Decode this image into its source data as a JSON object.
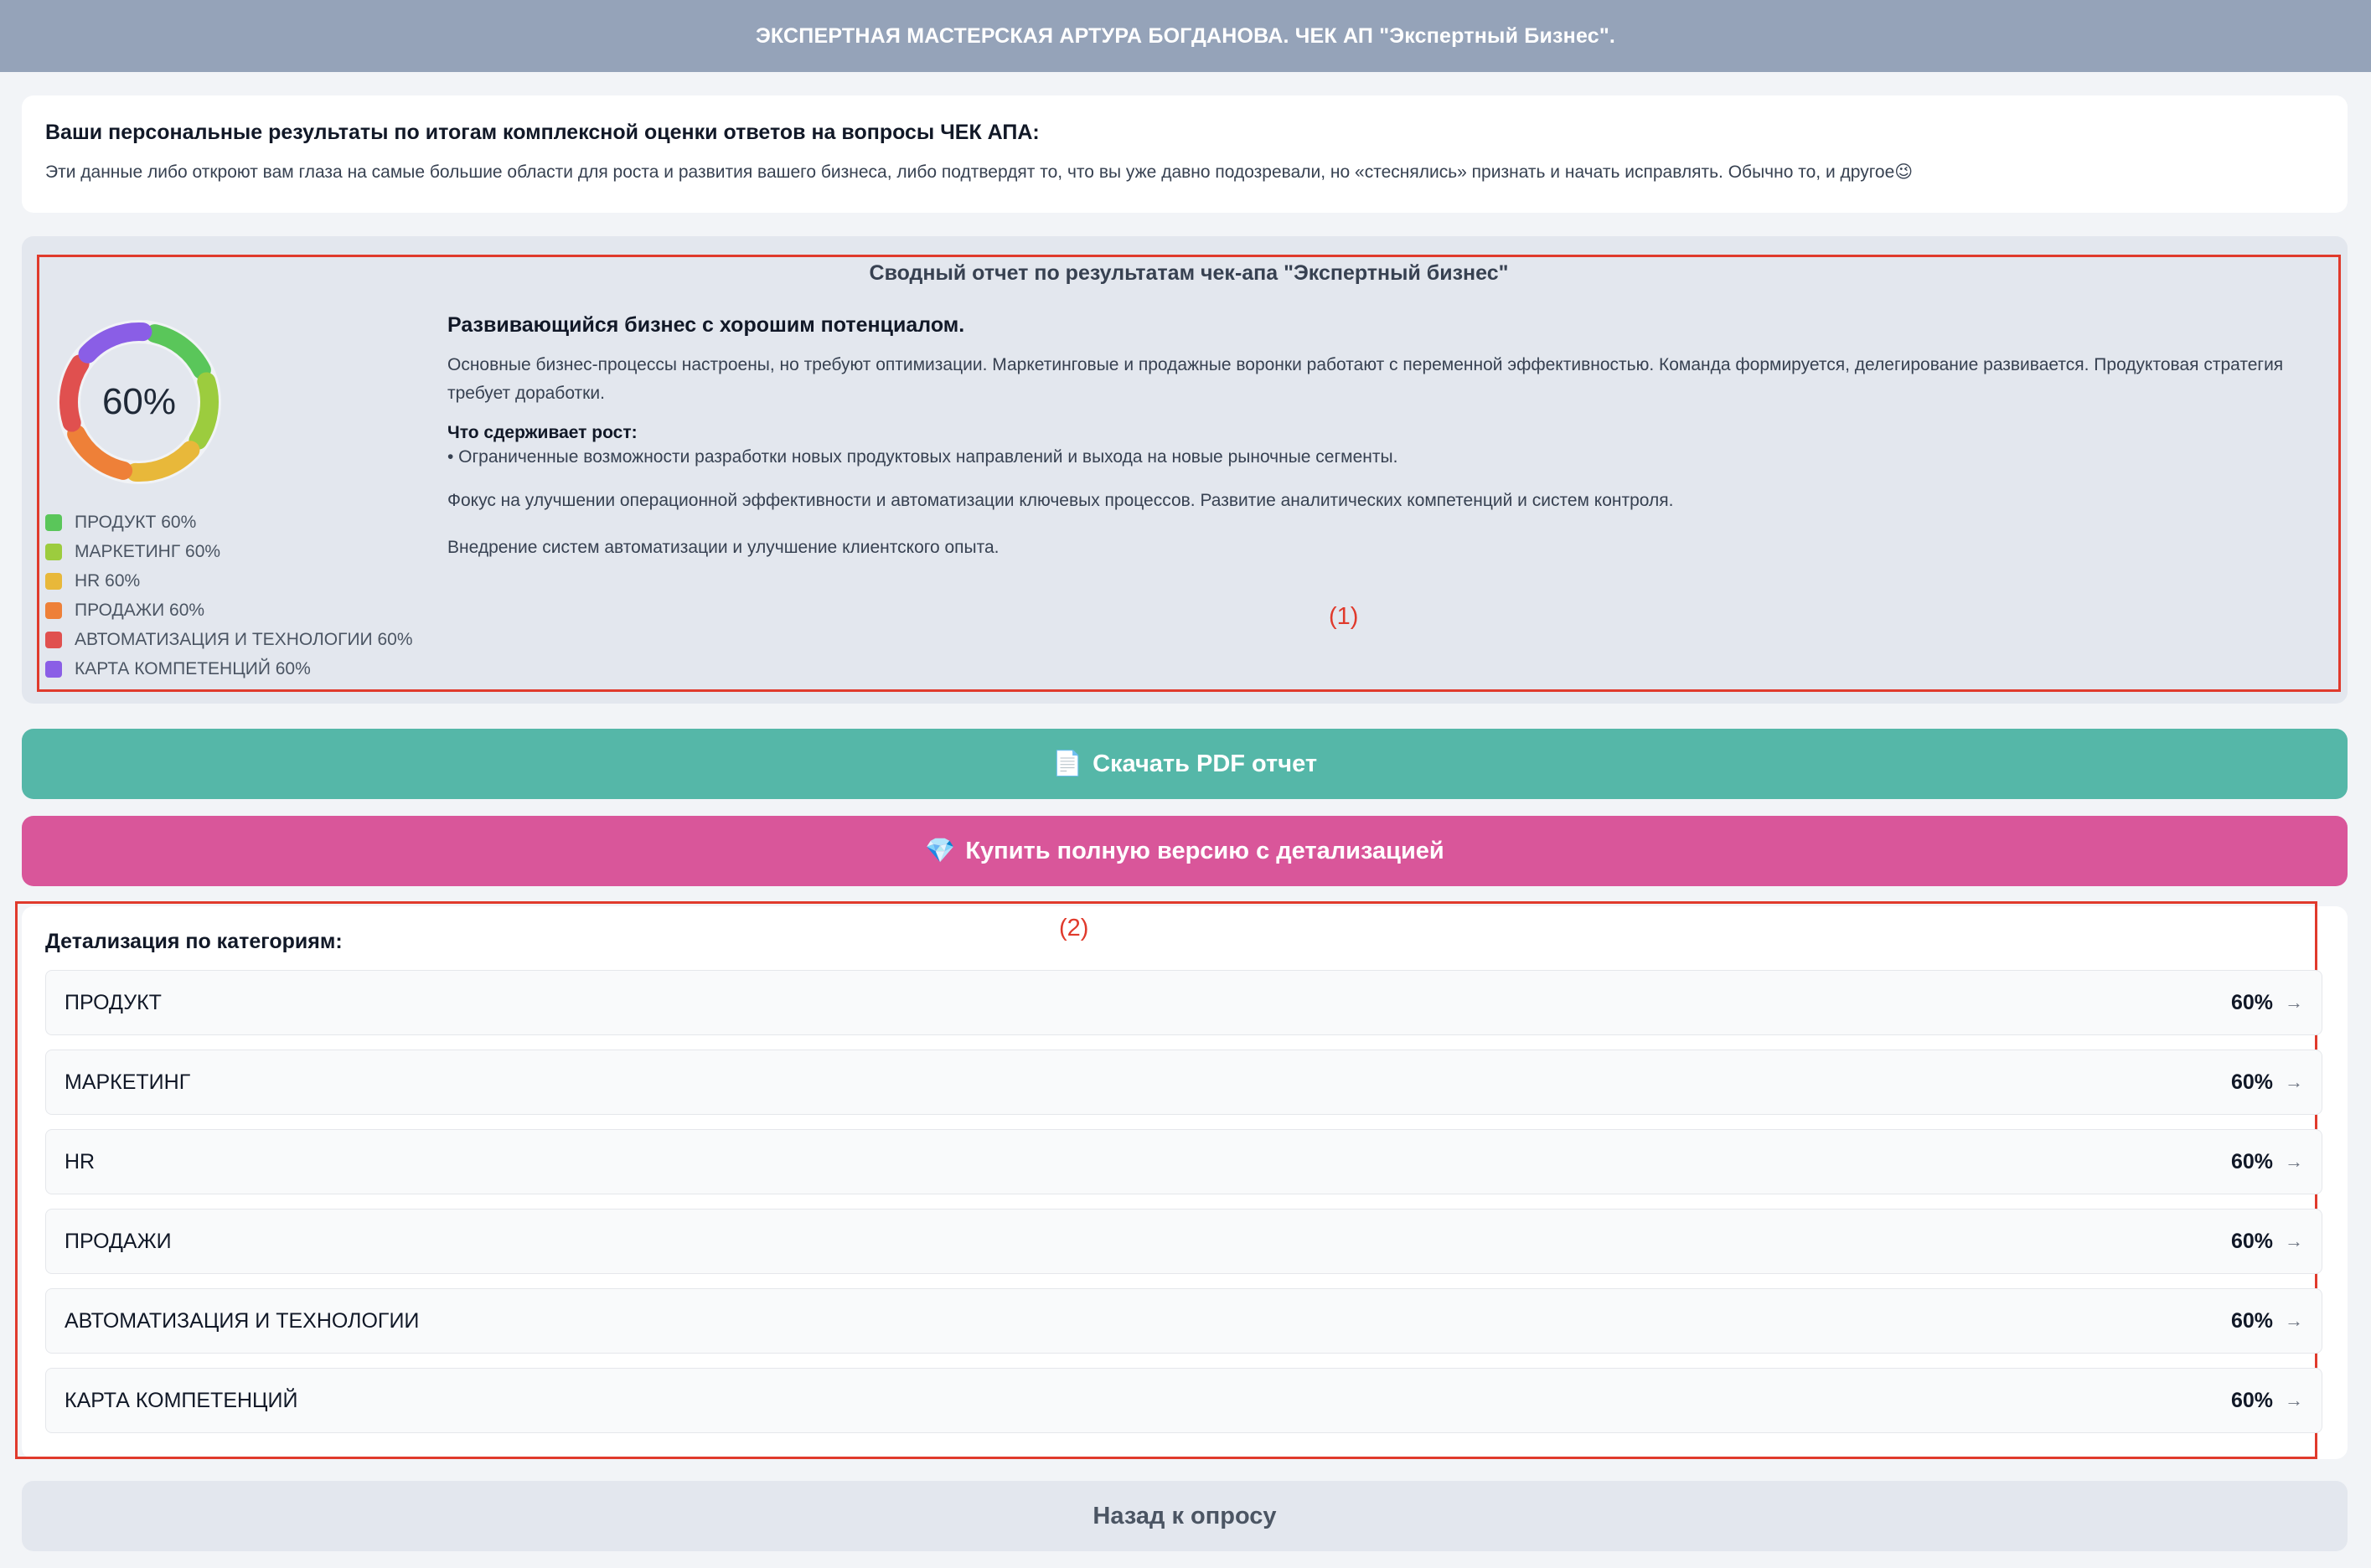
{
  "header": {
    "title": "ЭКСПЕРТНАЯ МАСТЕРСКАЯ АРТУРА БОГДАНОВА. ЧЕК АП \"Экспертный Бизнес\"."
  },
  "intro": {
    "title": "Ваши персональные результаты по итогам комплексной оценки ответов на вопросы ЧЕК АПА:",
    "text": "Эти данные либо откроют вам глаза на самые большие области для роста и развития вашего бизнеса, либо подтвердят то, что вы уже давно подозревали, но «стеснялись» признать и начать исправлять. Обычно то, и другое😉"
  },
  "summary": {
    "title": "Сводный отчет по результатам чек-апа \"Экспертный бизнес\"",
    "score_label": "60%",
    "score_value": 60,
    "legend": [
      {
        "label": "ПРОДУКТ 60%",
        "color": "#5ac65a",
        "value": 60
      },
      {
        "label": "МАРКЕТИНГ 60%",
        "color": "#9ccc3e",
        "value": 60
      },
      {
        "label": "HR 60%",
        "color": "#e8b83a",
        "value": 60
      },
      {
        "label": "ПРОДАЖИ 60%",
        "color": "#ee8038",
        "value": 60
      },
      {
        "label": "АВТОМАТИЗАЦИЯ И ТЕХНОЛОГИИ 60%",
        "color": "#e0504f",
        "value": 60
      },
      {
        "label": "КАРТА КОМПЕТЕНЦИЙ 60%",
        "color": "#8a5ee6",
        "value": 60
      }
    ],
    "heading": "Развивающийся бизнес с хорошим потенциалом.",
    "description": "Основные бизнес-процессы настроены, но требуют оптимизации. Маркетинговые и продажные воронки работают с переменной эффективностью. Команда формируется, делегирование развивается. Продуктовая стратегия требует доработки.",
    "growth_title": "Что сдерживает рост:",
    "growth_item": "• Ограниченные возможности разработки новых продуктовых направлений и выхода на новые рыночные сегменты.",
    "focus": "Фокус на улучшении операционной эффективности и автоматизации ключевых процессов. Развитие аналитических компетенций и систем контроля.",
    "implementation": "Внедрение систем автоматизации и улучшение клиентского опыта."
  },
  "annotations": {
    "label1": "(1)",
    "label2": "(2)"
  },
  "buttons": {
    "pdf_icon": "📄",
    "pdf_label": "Скачать PDF отчет",
    "buy_icon": "💎",
    "buy_label": "Купить полную версию с детализацией",
    "back_label": "Назад к опросу"
  },
  "details": {
    "title": "Детализация по категориям:",
    "arrow": "→",
    "categories": [
      {
        "name": "ПРОДУКТ",
        "value": "60%"
      },
      {
        "name": "МАРКЕТИНГ",
        "value": "60%"
      },
      {
        "name": "HR",
        "value": "60%"
      },
      {
        "name": "ПРОДАЖИ",
        "value": "60%"
      },
      {
        "name": "АВТОМАТИЗАЦИЯ И ТЕХНОЛОГИИ",
        "value": "60%"
      },
      {
        "name": "КАРТА КОМПЕТЕНЦИЙ",
        "value": "60%"
      }
    ]
  }
}
